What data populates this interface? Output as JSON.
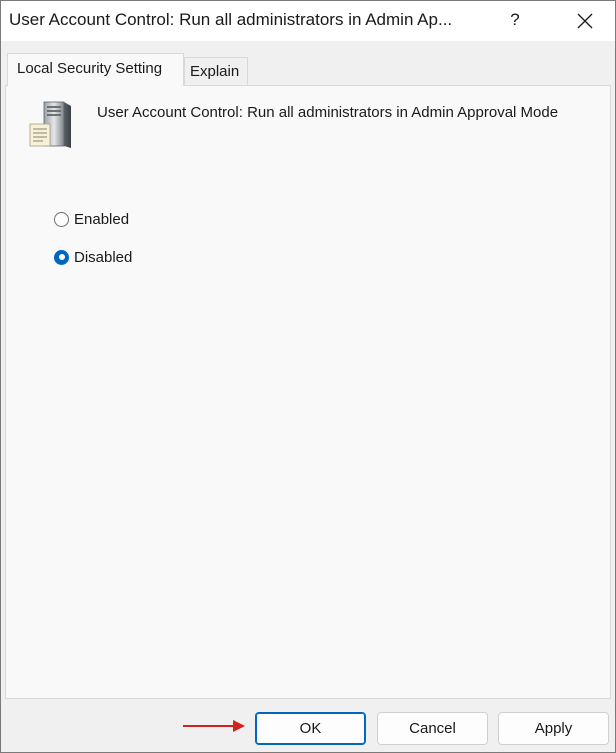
{
  "window": {
    "title": "User Account Control: Run all administrators in Admin Ap...",
    "help_label": "?",
    "close_icon": "close-icon"
  },
  "tabs": [
    {
      "label": "Local Security Setting",
      "active": true
    },
    {
      "label": "Explain",
      "active": false
    }
  ],
  "policy": {
    "icon": "server-document-icon",
    "title": "User Account Control: Run all administrators in Admin Approval Mode"
  },
  "options": [
    {
      "label": "Enabled",
      "selected": false
    },
    {
      "label": "Disabled",
      "selected": true
    }
  ],
  "buttons": {
    "ok": "OK",
    "cancel": "Cancel",
    "apply": "Apply"
  },
  "annotation": {
    "icon": "arrow-right-icon",
    "color": "#d42020"
  },
  "colors": {
    "accent": "#0067c0",
    "panel_bg": "#f9f9f9",
    "frame_bg": "#f0f0f0"
  }
}
